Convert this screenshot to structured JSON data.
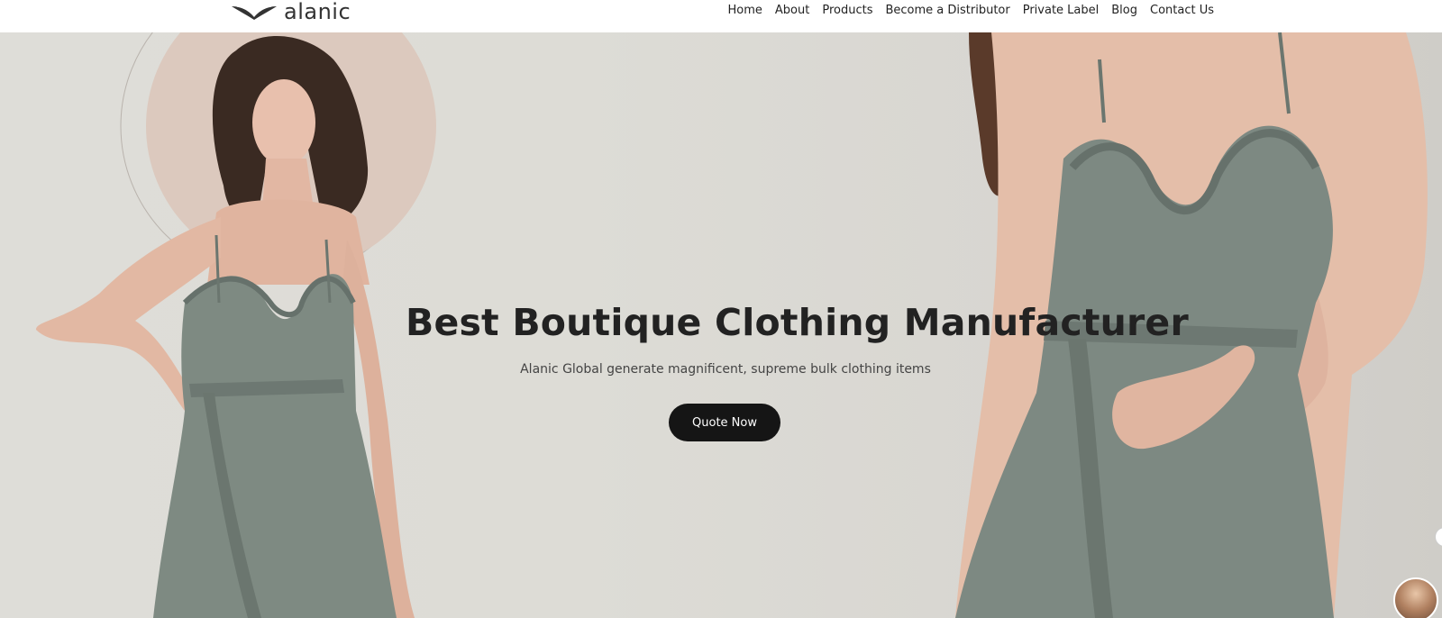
{
  "header": {
    "logo_text": "alanic",
    "nav": [
      "Home",
      "About",
      "Products",
      "Become a Distributor",
      "Private Label",
      "Blog",
      "Contact Us"
    ]
  },
  "hero": {
    "headline": "Best Boutique Clothing Manufacturer",
    "subheadline": "Alanic Global generate magnificent, supreme bulk clothing items",
    "cta_label": "Quote Now"
  },
  "colors": {
    "background": "#dddcd6",
    "dress": "#7c877f",
    "button": "#151515",
    "accent_circle": "#dbc8bd"
  }
}
